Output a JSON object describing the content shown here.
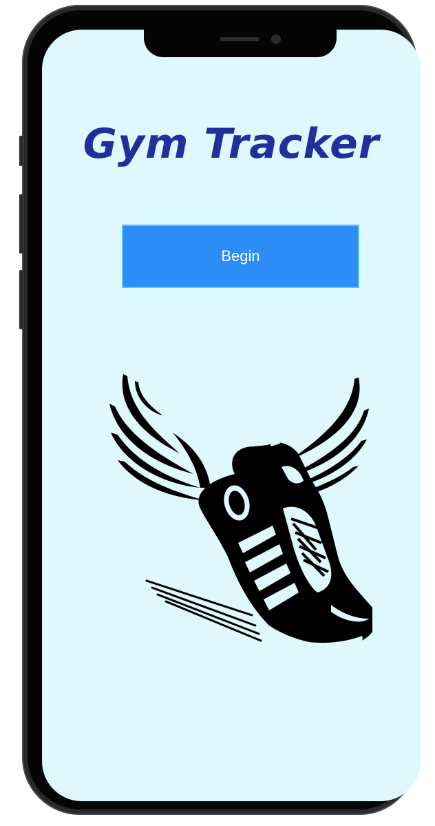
{
  "app": {
    "title": "Gym Tracker"
  },
  "actions": {
    "begin_label": "Begin"
  },
  "logo": {
    "icon": "winged-running-shoe-icon"
  },
  "colors": {
    "screen_background": "#dff8fe",
    "title": "#1f2f9c",
    "button": "#2c8cf8",
    "button_border": "#52c4f4",
    "button_text": "#ffffff"
  }
}
